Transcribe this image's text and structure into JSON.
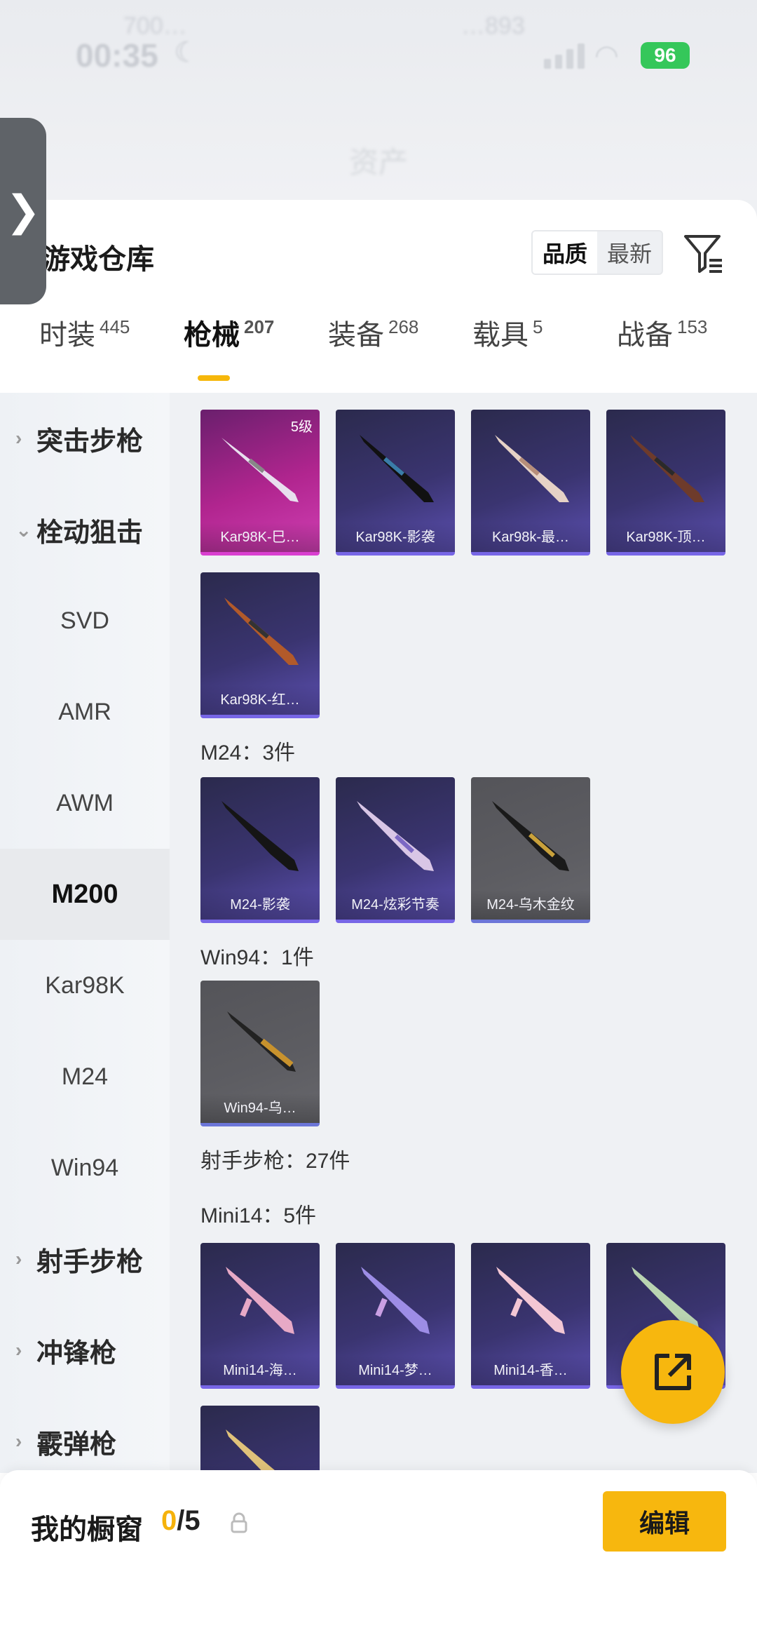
{
  "status": {
    "time": "00:35",
    "battery": "96",
    "faded_left": "700…",
    "faded_mid": "…893"
  },
  "header": {
    "title": "资产"
  },
  "panel": {
    "title": "游戏仓库",
    "sort": {
      "quality": "品质",
      "newest": "最新"
    }
  },
  "tabs": [
    {
      "label": "时装",
      "count": "445"
    },
    {
      "label": "枪械",
      "count": "207"
    },
    {
      "label": "装备",
      "count": "268"
    },
    {
      "label": "载具",
      "count": "5"
    },
    {
      "label": "战备",
      "count": "153"
    }
  ],
  "categories": {
    "assault": "突击步枪",
    "bolt": "栓动狙击",
    "sub": [
      "SVD",
      "AMR",
      "AWM",
      "M200",
      "Kar98K",
      "M24",
      "Win94"
    ],
    "marksman": "射手步枪",
    "smg": "冲锋枪",
    "shotgun": "霰弹枪"
  },
  "cards": {
    "kar98k": [
      "Kar98K-巳…",
      "Kar98K-影袭",
      "Kar98k-最…",
      "Kar98K-顶…",
      "Kar98K-红…"
    ],
    "kar98k_level": "5级",
    "m24": [
      "M24-影袭",
      "M24-炫彩节奏",
      "M24-乌木金纹"
    ],
    "win94": [
      "Win94-乌…"
    ],
    "mini14": [
      "Mini14-海…",
      "Mini14-梦…",
      "Mini14-香…"
    ]
  },
  "sections": {
    "m24": "M24：3件",
    "win94": "Win94：1件",
    "marksman": "射手步枪：27件",
    "mini14": "Mini14：5件"
  },
  "bottom": {
    "label": "我的橱窗",
    "current": "0",
    "total": "/5",
    "edit": "编辑"
  },
  "colors": {
    "accent": "#f7b70e",
    "card_purple": "#3a3470",
    "card_pink": "#b1258f",
    "card_gray": "#5d5d62"
  }
}
